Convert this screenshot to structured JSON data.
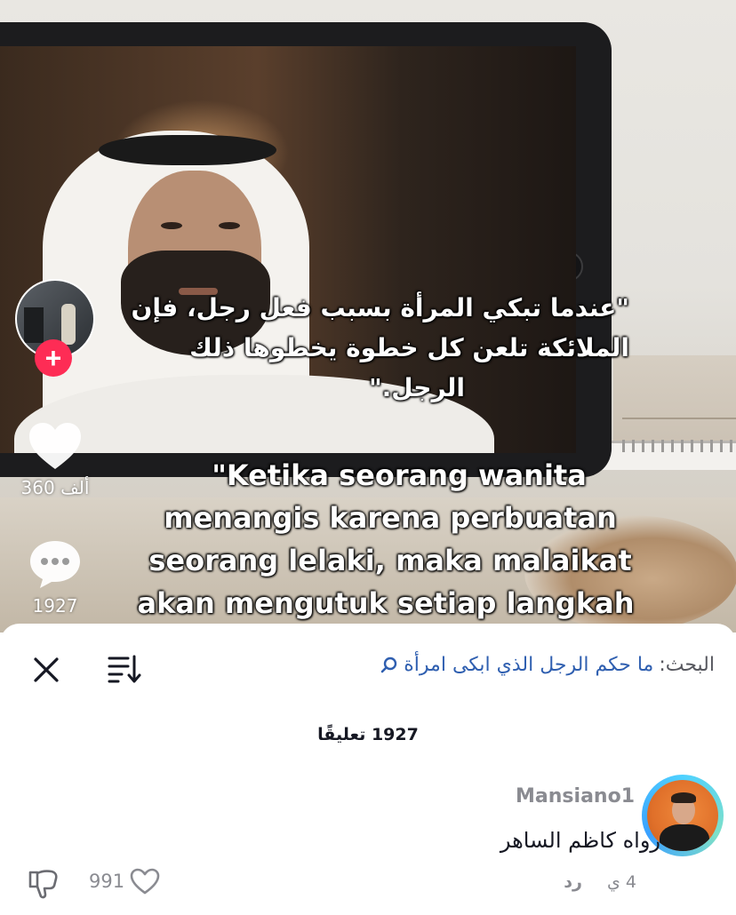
{
  "video": {
    "arabic_caption": [
      "\"عندما تبكي المرأة بسبب فعل رجل، فإن",
      "الملائكة تلعن كل خطوة يخطوها ذلك",
      "الرجل.\""
    ],
    "indonesian_caption": [
      "\"Ketika seorang wanita",
      "menangis karena perbuatan",
      "seorang lelaki, maka malaikat",
      "akan mengutuk setiap langkah"
    ]
  },
  "side_actions": {
    "follow_label": "+",
    "likes_count": "360 ألف",
    "comments_count": "1927",
    "like_icon": "heart-icon",
    "comment_icon": "comment-bubble-icon"
  },
  "comments_sheet": {
    "search_label": "البحث:",
    "search_query": "ما حكم الرجل الذي ابكى امرأة",
    "search_icon": "search-icon",
    "title": "1927 تعليقًا",
    "comments": [
      {
        "username": "Mansiano1",
        "text": "رواه كاظم الساهر",
        "age": "4 ي",
        "reply_label": "رد",
        "like_count": "991"
      }
    ]
  },
  "colors": {
    "follow_red": "#fe2c55",
    "search_link_blue": "#2f5fb0",
    "muted_gray": "#8a8b91",
    "text_dark": "#161823"
  }
}
